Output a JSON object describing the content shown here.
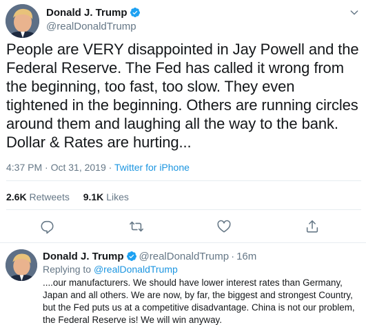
{
  "tweet": {
    "author_name": "Donald J. Trump",
    "author_handle": "@realDonaldTrump",
    "verified": true,
    "text": "People are VERY disappointed in Jay Powell and the Federal Reserve. The Fed has called it wrong from the beginning, too fast, too slow. They even tightened in the beginning. Others are running circles around them and laughing all the way to the bank. Dollar & Rates are hurting...",
    "time": "4:37 PM",
    "date": "Oct 31, 2019",
    "separator": " · ",
    "source": "Twitter for iPhone",
    "retweets_count": "2.6K",
    "retweets_label": "Retweets",
    "likes_count": "9.1K",
    "likes_label": "Likes"
  },
  "actions": {
    "reply_icon": "comment-icon",
    "retweet_icon": "retweet-icon",
    "like_icon": "heart-icon",
    "share_icon": "share-icon"
  },
  "reply": {
    "author_name": "Donald J. Trump",
    "verified": true,
    "author_handle": "@realDonaldTrump",
    "age": "16m",
    "replying_label": "Replying to",
    "replying_to": "@realDonaldTrump",
    "text": "....our manufacturers. We should have lower interest rates than Germany, Japan and all others. We are now, by far, the biggest and strongest Country, but the Fed puts us at a competitive disadvantage. China is not our problem, the Federal Reserve is! We will win anyway."
  },
  "colors": {
    "link": "#1b95e0",
    "secondary_text": "#657786",
    "primary_text": "#14171a",
    "divider": "#e6ecf0",
    "verified_badge": "#1da1f2"
  }
}
